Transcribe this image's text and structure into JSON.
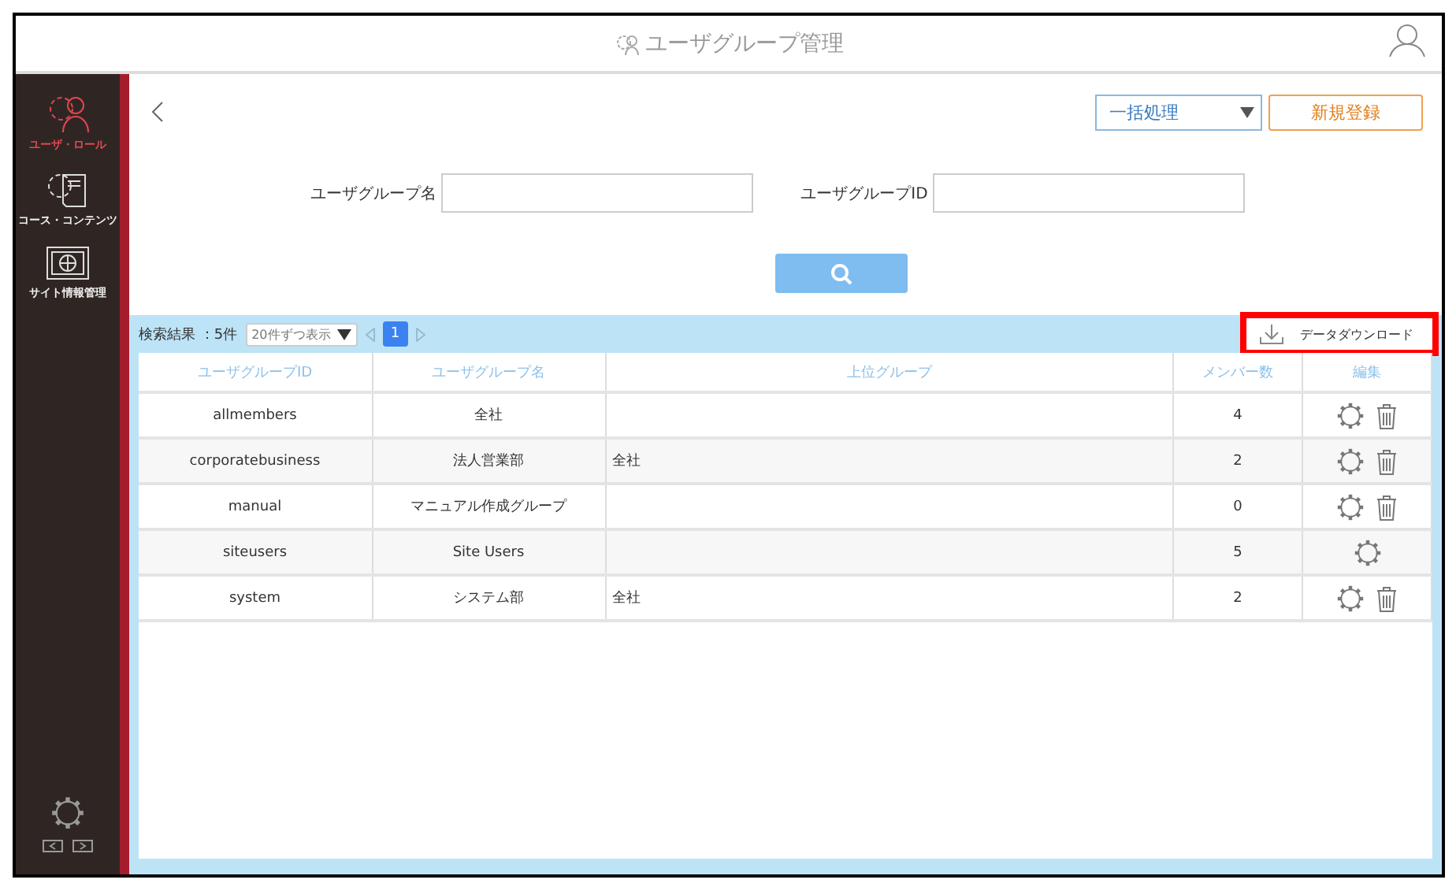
{
  "header": {
    "title": "ユーザグループ管理"
  },
  "sidebar": {
    "items": [
      {
        "label": "ユーザ・ロール",
        "selected": true,
        "kind": "users"
      },
      {
        "label": "コース・コンテンツ",
        "selected": false,
        "kind": "book"
      },
      {
        "label": "サイト情報管理",
        "selected": false,
        "kind": "globe"
      }
    ]
  },
  "toolbar": {
    "bulk_select": "一括処理",
    "new_button": "新規登録"
  },
  "search": {
    "fields": [
      {
        "label": "ユーザグループ名"
      },
      {
        "label": "ユーザグループID"
      }
    ]
  },
  "results": {
    "count": "検索結果 ：5件",
    "per_page": "20件ずつ表示",
    "pages": [
      {
        "label": "1",
        "selected": true
      }
    ],
    "download": "データダウンロード",
    "download_highlighted": true
  },
  "table": {
    "columns": [
      "ユーザグループID",
      "ユーザグループ名",
      "上位グループ",
      "メンバー数",
      "編集"
    ],
    "rows": [
      {
        "id": "allmembers",
        "name": "全社",
        "parent": "",
        "members": "4",
        "deletable": true
      },
      {
        "id": "corporatebusiness",
        "name": "法人営業部",
        "parent": "全社",
        "members": "2",
        "deletable": true
      },
      {
        "id": "manual",
        "name": "マニュアル作成グループ",
        "parent": "",
        "members": "0",
        "deletable": true
      },
      {
        "id": "siteusers",
        "name": "Site Users",
        "parent": "",
        "members": "5",
        "deletable": false
      },
      {
        "id": "system",
        "name": "システム部",
        "parent": "全社",
        "members": "2",
        "deletable": true
      }
    ]
  }
}
